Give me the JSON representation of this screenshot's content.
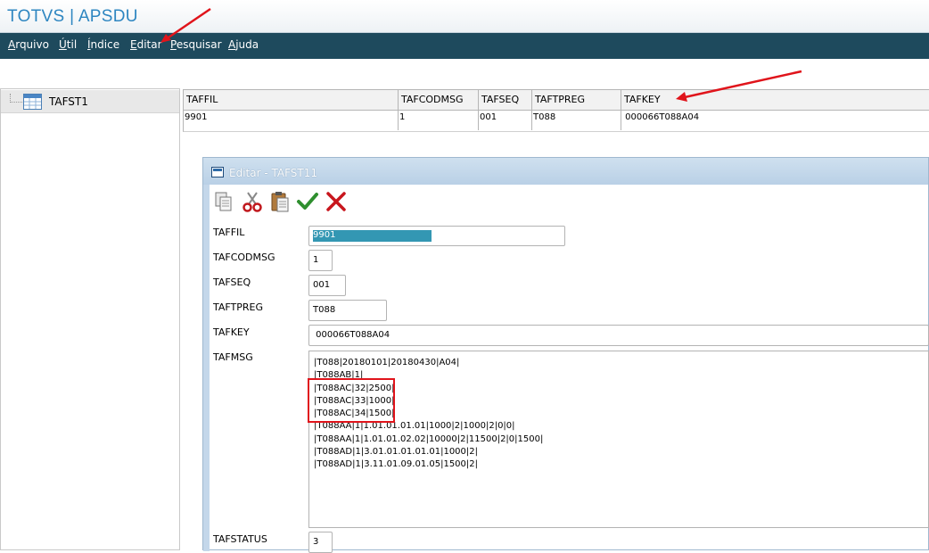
{
  "app": {
    "title": "TOTVS | APSDU"
  },
  "menu": [
    {
      "accel": "A",
      "rest": "rquivo"
    },
    {
      "accel": "Ú",
      "rest": "til"
    },
    {
      "accel": "Í",
      "rest": "ndice"
    },
    {
      "accel": "E",
      "rest": "ditar"
    },
    {
      "accel": "P",
      "rest": "esquisar"
    },
    {
      "accel": "A",
      "rest": "juda"
    }
  ],
  "tree": {
    "items": [
      {
        "label": "TAFST1",
        "icon": "table-icon"
      }
    ]
  },
  "grid": {
    "columns": [
      "TAFFIL",
      "TAFCODMSG",
      "TAFSEQ",
      "TAFTPREG",
      "TAFKEY"
    ],
    "rows": [
      [
        "9901",
        "1",
        "001",
        "T088",
        " 000066T088A04"
      ]
    ]
  },
  "dialog": {
    "title": "Editar - TAFST11",
    "toolbar": [
      "copy-icon",
      "cut-icon",
      "paste-icon",
      "confirm-check-icon",
      "cancel-x-icon"
    ],
    "fields": {
      "taffil": {
        "label": "TAFFIL",
        "value": "9901"
      },
      "tafcodmsg": {
        "label": "TAFCODMSG",
        "value": "1"
      },
      "tafseq": {
        "label": "TAFSEQ",
        "value": "001"
      },
      "taftpreg": {
        "label": "TAFTPREG",
        "value": "T088"
      },
      "tafkey": {
        "label": "TAFKEY",
        "value": " 000066T088A04"
      },
      "tafmsg": {
        "label": "TAFMSG",
        "lines": [
          "|T088|20180101|20180430|A04|",
          "|T088AB|1|",
          "|T088AC|32|2500|",
          "|T088AC|33|1000|",
          "|T088AC|34|1500|",
          "|T088AA|1|1.01.01.01.01|1000|2|1000|2|0|0|",
          "|T088AA|1|1.01.01.02.02|10000|2|11500|2|0|1500|",
          "|T088AD|1|3.01.01.01.01.01|1000|2|",
          "|T088AD|1|3.11.01.09.01.05|1500|2|"
        ]
      },
      "tafstatus": {
        "label": "TAFSTATUS",
        "value": "3"
      }
    }
  },
  "annotations": {
    "color": "#e0141b"
  }
}
